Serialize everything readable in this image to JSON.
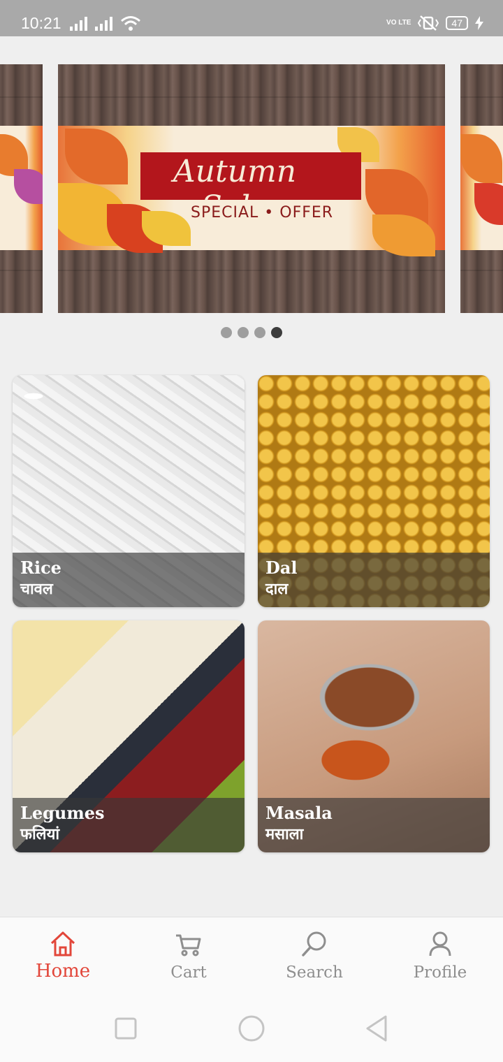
{
  "status_bar": {
    "time": "10:21",
    "network_label": "VO LTE",
    "battery": "47"
  },
  "carousel": {
    "banner_title": "Autumn Sale",
    "banner_subtitle": "SPECIAL • OFFER",
    "slide_count": 4,
    "active_slide": 4
  },
  "categories": [
    {
      "name": "Rice",
      "hindi": "चावल"
    },
    {
      "name": "Dal",
      "hindi": "दाल"
    },
    {
      "name": "Legumes",
      "hindi": "फलियां"
    },
    {
      "name": "Masala",
      "hindi": "मसाला"
    }
  ],
  "bottom_nav": [
    {
      "label": "Home",
      "icon": "home-icon",
      "active": true
    },
    {
      "label": "Cart",
      "icon": "cart-icon",
      "active": false
    },
    {
      "label": "Search",
      "icon": "search-icon",
      "active": false
    },
    {
      "label": "Profile",
      "icon": "profile-icon",
      "active": false
    }
  ],
  "colors": {
    "accent": "#e2463a",
    "inactive": "#8e8e8e",
    "status_bar": "#a9a9a9"
  }
}
